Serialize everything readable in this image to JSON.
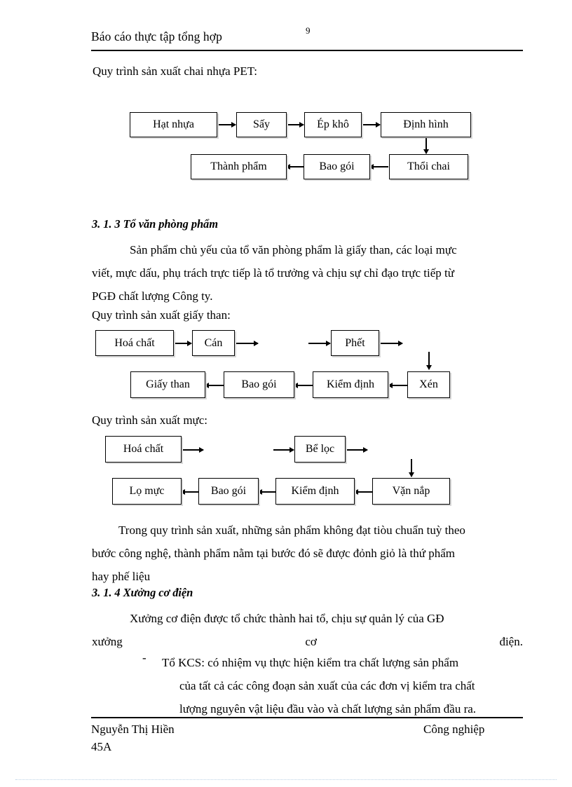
{
  "header": {
    "title": "Báo cáo thực tập tổng hợp",
    "page_number": "9"
  },
  "body": {
    "lead_pet": "Quy trình sản xuất chai nhựa PET:",
    "heading_313": "3. 1. 3 Tổ văn phòng phẩm",
    "para_313": {
      "line1": "Sản phẩm chủ yếu của tổ văn phòng phẩm là giấy than, các loại mực",
      "line2": "viết, mực dấu, phụ trách trực tiếp là tổ trưởng và chịu sự chỉ đạo trực tiếp từ",
      "line3": "PGĐ chất lượng Công ty."
    },
    "lead_giay_than": "Quy trình sản xuất giấy than:",
    "lead_muc": "Quy trình sản xuất mực:",
    "para_quytrinh": {
      "line1": "Trong quy trình sản xuất, những sản phẩm không đạt tiòu chuẩn tuỳ theo",
      "line2": "bước công nghệ, thành phẩm nằm tại bước đó sẽ được đỏnh giỏ là thứ phẩm",
      "line3": "hay phế liệu"
    },
    "heading_314": "3. 1. 4 Xưởng cơ điện",
    "para_314": {
      "line1": "Xưởng cơ điện được tổ chức thành hai tổ, chịu sự quản lý của GĐ",
      "line2_a": "xưởng",
      "line2_b": "cơ",
      "line2_c": "điện."
    },
    "list": [
      {
        "marker": "-",
        "line1": "Tổ KCS: có nhiệm vụ thực hiện kiểm tra chất lượng sản phẩm",
        "line2": "của tất cả các công đoạn sản xuất của các đơn vị kiểm tra chất",
        "line3": "lượng nguyên vật liệu đầu vào và chất lượng sản phẩm đầu ra."
      }
    ]
  },
  "flowchart_pet": {
    "nodes": [
      {
        "label": "Hạt nhựa"
      },
      {
        "label": "Sấy"
      },
      {
        "label": "Ép khô"
      },
      {
        "label": "Định hình"
      },
      {
        "label": "Thổi chai"
      },
      {
        "label": "Bao gói"
      },
      {
        "label": "Thành phẩm"
      }
    ]
  },
  "flowchart_giay_than": {
    "nodes": [
      {
        "label": "Hoá chất"
      },
      {
        "label": "Cán"
      },
      {
        "label": "Phết"
      },
      {
        "label": "Xén"
      },
      {
        "label": "Kiểm định"
      },
      {
        "label": "Bao gói"
      },
      {
        "label": "Giấy than"
      }
    ]
  },
  "flowchart_muc": {
    "nodes": [
      {
        "label": "Hoá chất"
      },
      {
        "label": "Bể lọc"
      },
      {
        "label": "Vặn nắp"
      },
      {
        "label": "Kiểm định"
      },
      {
        "label": "Bao gói"
      },
      {
        "label": "Lọ mực"
      }
    ]
  },
  "footer": {
    "author": "Nguyễn Thị Hiền",
    "department": "Công nghiệp",
    "class": "45A"
  }
}
